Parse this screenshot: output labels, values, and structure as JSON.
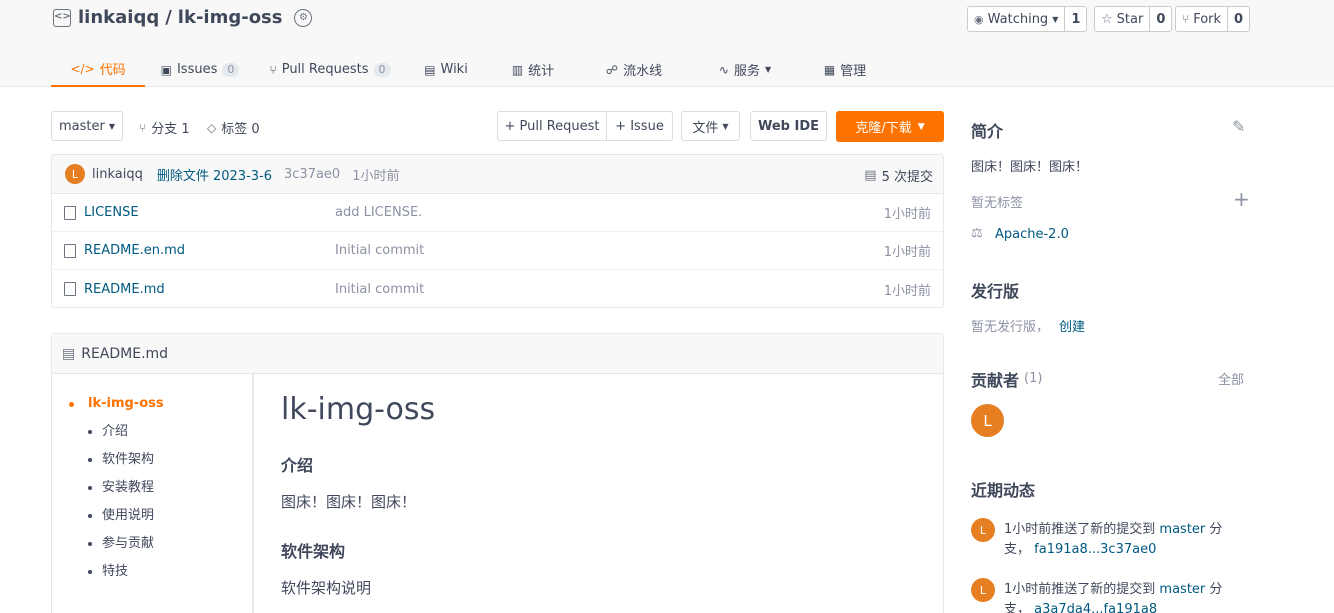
{
  "repo": {
    "owner": "linkaiqq",
    "separator": "/",
    "name": "lk-img-oss"
  },
  "header_buttons": {
    "watch": {
      "label": "Watching",
      "count": "1"
    },
    "star": {
      "label": "Star",
      "count": "0"
    },
    "fork": {
      "label": "Fork",
      "count": "0"
    }
  },
  "tabs": [
    {
      "label": "代码",
      "active": true
    },
    {
      "label": "Issues",
      "count": "0"
    },
    {
      "label": "Pull Requests",
      "count": "0"
    },
    {
      "label": "Wiki"
    },
    {
      "label": "统计"
    },
    {
      "label": "流水线"
    },
    {
      "label": "服务"
    },
    {
      "label": "管理"
    }
  ],
  "toolbar": {
    "branch": "master",
    "branches": "分支 1",
    "tags": "标签 0",
    "pull_request": "+ Pull Request",
    "issue": "+ Issue",
    "file": "文件",
    "web_ide": "Web IDE",
    "clone": "克隆/下载"
  },
  "last_commit": {
    "avatar": "L",
    "author": "linkaiqq",
    "message": "删除文件 2023-3-6",
    "hash": "3c37ae0",
    "time": "1小时前",
    "commits": "5 次提交"
  },
  "files": [
    {
      "name": "LICENSE",
      "message": "add LICENSE.",
      "time": "1小时前"
    },
    {
      "name": "README.en.md",
      "message": "Initial commit",
      "time": "1小时前"
    },
    {
      "name": "README.md",
      "message": "Initial commit",
      "time": "1小时前"
    }
  ],
  "readme": {
    "title": "README.md",
    "toc": [
      {
        "label": "lk-img-oss",
        "level": 1
      },
      {
        "label": "介绍",
        "level": 2
      },
      {
        "label": "软件架构",
        "level": 2
      },
      {
        "label": "安装教程",
        "level": 2
      },
      {
        "label": "使用说明",
        "level": 2
      },
      {
        "label": "参与贡献",
        "level": 2
      },
      {
        "label": "特技",
        "level": 2
      }
    ],
    "h1": "lk-img-oss",
    "intro_heading": "介绍",
    "intro_text": "图床！图床！图床！",
    "arch_heading": "软件架构",
    "arch_text": "软件架构说明"
  },
  "sidebar": {
    "intro_title": "简介",
    "intro_text": "图床！图床！图床！",
    "no_tags": "暂无标签",
    "license": "Apache-2.0",
    "release_title": "发行版",
    "no_release": "暂无发行版，",
    "create": "创建",
    "contributors_title": "贡献者",
    "contributors_count": "(1)",
    "all": "全部",
    "contributor_avatar": "L",
    "activity_title": "近期动态",
    "activities": [
      {
        "prefix": "1小时前推送了新的提交到",
        "branch": "master",
        "suffix": "分支，",
        "range": "fa191a8...3c37ae0"
      },
      {
        "prefix": "1小时前推送了新的提交到",
        "branch": "master",
        "suffix": "分支，",
        "range": "a3a7da4...fa191a8"
      }
    ]
  },
  "colors": {
    "accent": "#fe7300",
    "link": "#005980",
    "text": "#40485b",
    "muted": "#8c92a4"
  }
}
